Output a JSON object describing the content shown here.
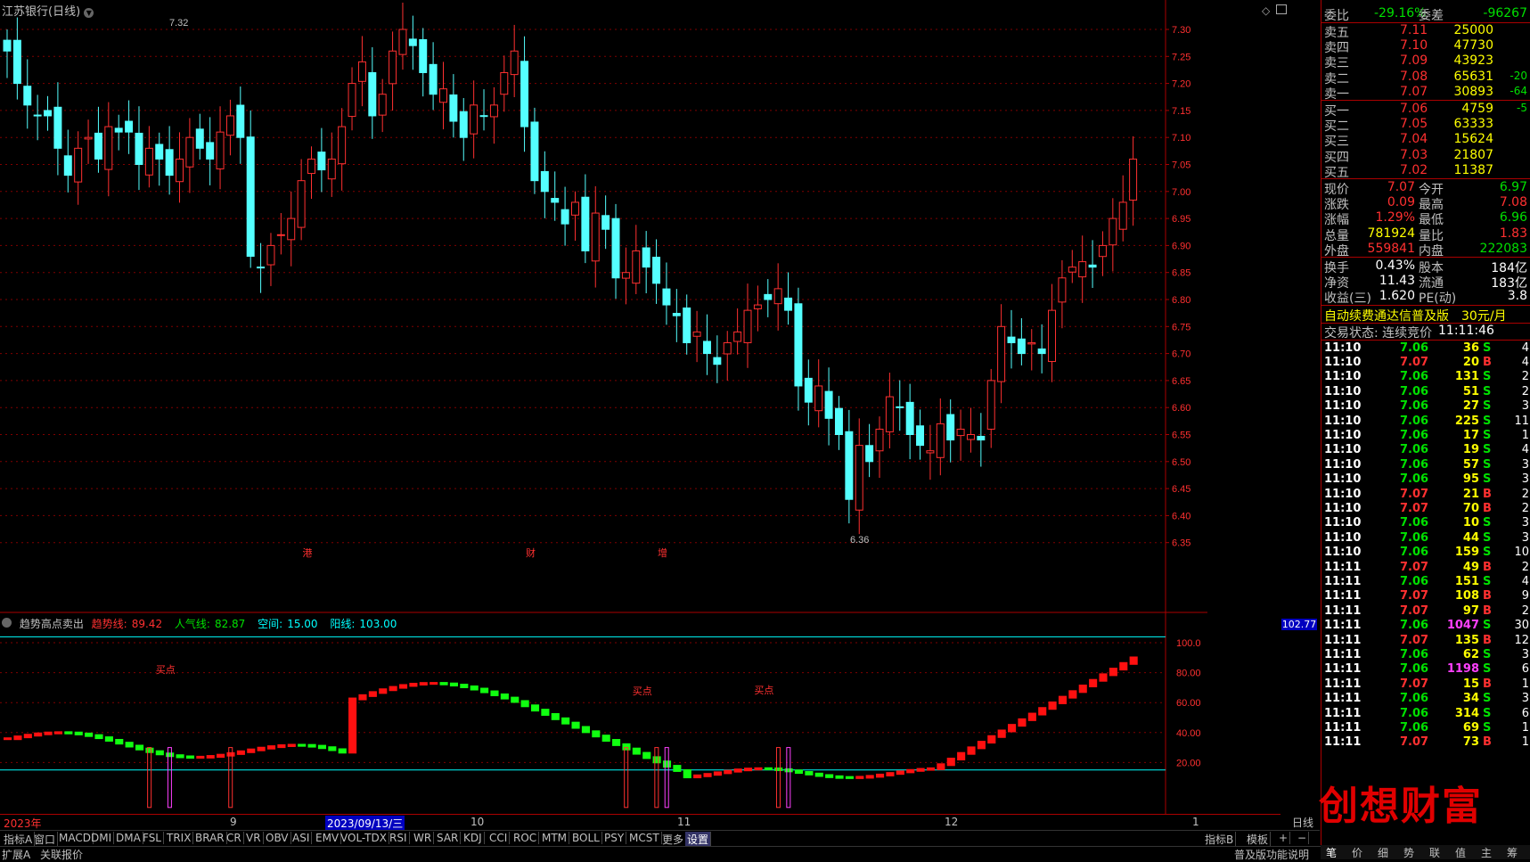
{
  "window": {
    "title": "江苏银行(日线)"
  },
  "colors": {
    "up": "#ff3030",
    "down": "#54ffff",
    "grid": "#800000",
    "accent": "#ffff00"
  },
  "main_chart": {
    "high_label": "7.32",
    "low_label": "6.36",
    "price_ticks": [
      "7.30",
      "7.25",
      "7.20",
      "7.15",
      "7.10",
      "7.05",
      "7.00",
      "6.95",
      "6.90",
      "6.85",
      "6.80",
      "6.75",
      "6.70",
      "6.65",
      "6.60",
      "6.55",
      "6.50",
      "6.45",
      "6.40",
      "6.35"
    ],
    "markers": [
      {
        "text": "港",
        "x_index": 30
      },
      {
        "text": "财",
        "x_index": 52
      },
      {
        "text": "增",
        "x_index": 65
      }
    ]
  },
  "indicator": {
    "name": "趋势高点卖出",
    "fields": [
      {
        "label": "趋势线:",
        "value": "89.42"
      },
      {
        "label": "人气线:",
        "value": "82.87"
      },
      {
        "label": "空间:",
        "value": "15.00"
      },
      {
        "label": "阳线:",
        "value": "103.00"
      }
    ],
    "current_value": "102.77",
    "ticks": [
      "100.0",
      "80.00",
      "60.00",
      "40.00",
      "20.00"
    ],
    "buy_labels": [
      "买点",
      "买点",
      "买点"
    ]
  },
  "x_axis": {
    "labels": [
      "2023年",
      "9",
      "2023/09/13/三",
      "10",
      "11",
      "12",
      "1"
    ],
    "period": "日线"
  },
  "tabs": [
    "指标A",
    "窗口",
    "MACD",
    "DMI",
    "DMA",
    "FSL",
    "TRIX",
    "BRAR",
    "CR",
    "VR",
    "OBV",
    "ASI",
    "EMV",
    "VOL-TDX",
    "RSI",
    "WR",
    "SAR",
    "KDJ",
    "CCI",
    "ROC",
    "MTM",
    "BOLL",
    "PSY",
    "MCST",
    "更多",
    "设置"
  ],
  "tabs_right": [
    "指标B",
    "模板",
    "+",
    "−"
  ],
  "statusbar": {
    "left": [
      "扩展A",
      "关联报价"
    ],
    "right": "普及版功能说明"
  },
  "quote": {
    "wei_bi": {
      "label": "委比",
      "value": "-29.16%",
      "label2": "委差",
      "value2": "-96267"
    },
    "sells": [
      {
        "label": "卖五",
        "price": "7.11",
        "vol": "25000",
        "chg": ""
      },
      {
        "label": "卖四",
        "price": "7.10",
        "vol": "47730",
        "chg": ""
      },
      {
        "label": "卖三",
        "price": "7.09",
        "vol": "43923",
        "chg": ""
      },
      {
        "label": "卖二",
        "price": "7.08",
        "vol": "65631",
        "chg": "-20"
      },
      {
        "label": "卖一",
        "price": "7.07",
        "vol": "30893",
        "chg": "-64"
      }
    ],
    "buys": [
      {
        "label": "买一",
        "price": "7.06",
        "vol": "4759",
        "chg": "-5"
      },
      {
        "label": "买二",
        "price": "7.05",
        "vol": "63333",
        "chg": ""
      },
      {
        "label": "买三",
        "price": "7.04",
        "vol": "15624",
        "chg": ""
      },
      {
        "label": "买四",
        "price": "7.03",
        "vol": "21807",
        "chg": ""
      },
      {
        "label": "买五",
        "price": "7.02",
        "vol": "11387",
        "chg": ""
      }
    ],
    "stats": [
      {
        "l1": "现价",
        "v1": "7.07",
        "c1": "red",
        "l2": "今开",
        "v2": "6.97",
        "c2": "green"
      },
      {
        "l1": "涨跌",
        "v1": "0.09",
        "c1": "red",
        "l2": "最高",
        "v2": "7.08",
        "c2": "red"
      },
      {
        "l1": "涨幅",
        "v1": "1.29%",
        "c1": "red",
        "l2": "最低",
        "v2": "6.96",
        "c2": "green"
      },
      {
        "l1": "总量",
        "v1": "781924",
        "c1": "yellow",
        "l2": "量比",
        "v2": "1.83",
        "c2": "red"
      },
      {
        "l1": "外盘",
        "v1": "559841",
        "c1": "red",
        "l2": "内盘",
        "v2": "222083",
        "c2": "green"
      }
    ],
    "stats2": [
      {
        "l1": "换手",
        "v1": "0.43%",
        "l2": "股本",
        "v2": "184亿"
      },
      {
        "l1": "净资",
        "v1": "11.43",
        "l2": "流通",
        "v2": "183亿"
      },
      {
        "l1": "收益(三)",
        "v1": "1.620",
        "l2": "PE(动)",
        "v2": "3.8"
      }
    ],
    "promo": {
      "text": "自动续费通达信普及版",
      "price": "30元/月"
    },
    "trade_state": {
      "label": "交易状态: 连续竞价",
      "time": "11:11:46"
    }
  },
  "ticks": [
    {
      "t": "11:10",
      "p": "7.06",
      "v": "36",
      "bs": "S",
      "n": "4"
    },
    {
      "t": "11:10",
      "p": "7.07",
      "v": "20",
      "bs": "B",
      "n": "4"
    },
    {
      "t": "11:10",
      "p": "7.06",
      "v": "131",
      "bs": "S",
      "n": "2"
    },
    {
      "t": "11:10",
      "p": "7.06",
      "v": "51",
      "bs": "S",
      "n": "2"
    },
    {
      "t": "11:10",
      "p": "7.06",
      "v": "27",
      "bs": "S",
      "n": "3"
    },
    {
      "t": "11:10",
      "p": "7.06",
      "v": "225",
      "bs": "S",
      "n": "11"
    },
    {
      "t": "11:10",
      "p": "7.06",
      "v": "17",
      "bs": "S",
      "n": "1"
    },
    {
      "t": "11:10",
      "p": "7.06",
      "v": "19",
      "bs": "S",
      "n": "4"
    },
    {
      "t": "11:10",
      "p": "7.06",
      "v": "57",
      "bs": "S",
      "n": "3"
    },
    {
      "t": "11:10",
      "p": "7.06",
      "v": "95",
      "bs": "S",
      "n": "3"
    },
    {
      "t": "11:10",
      "p": "7.07",
      "v": "21",
      "bs": "B",
      "n": "2"
    },
    {
      "t": "11:10",
      "p": "7.07",
      "v": "70",
      "bs": "B",
      "n": "2"
    },
    {
      "t": "11:10",
      "p": "7.06",
      "v": "10",
      "bs": "S",
      "n": "3"
    },
    {
      "t": "11:10",
      "p": "7.06",
      "v": "44",
      "bs": "S",
      "n": "3"
    },
    {
      "t": "11:10",
      "p": "7.06",
      "v": "159",
      "bs": "S",
      "n": "10"
    },
    {
      "t": "11:11",
      "p": "7.07",
      "v": "49",
      "bs": "B",
      "n": "2"
    },
    {
      "t": "11:11",
      "p": "7.06",
      "v": "151",
      "bs": "S",
      "n": "4"
    },
    {
      "t": "11:11",
      "p": "7.07",
      "v": "108",
      "bs": "B",
      "n": "9"
    },
    {
      "t": "11:11",
      "p": "7.07",
      "v": "97",
      "bs": "B",
      "n": "2"
    },
    {
      "t": "11:11",
      "p": "7.06",
      "v": "1047",
      "bs": "S",
      "n": "30"
    },
    {
      "t": "11:11",
      "p": "7.07",
      "v": "135",
      "bs": "B",
      "n": "12"
    },
    {
      "t": "11:11",
      "p": "7.06",
      "v": "62",
      "bs": "S",
      "n": "3"
    },
    {
      "t": "11:11",
      "p": "7.06",
      "v": "1198",
      "bs": "S",
      "n": "6"
    },
    {
      "t": "11:11",
      "p": "7.07",
      "v": "15",
      "bs": "B",
      "n": "1"
    },
    {
      "t": "11:11",
      "p": "7.06",
      "v": "34",
      "bs": "S",
      "n": "3"
    },
    {
      "t": "11:11",
      "p": "7.06",
      "v": "314",
      "bs": "S",
      "n": "6"
    },
    {
      "t": "11:11",
      "p": "7.06",
      "v": "69",
      "bs": "S",
      "n": "1"
    },
    {
      "t": "11:11",
      "p": "7.07",
      "v": "73",
      "bs": "B",
      "n": "1"
    }
  ],
  "right_tabs": [
    "笔",
    "价",
    "细",
    "势",
    "联",
    "值",
    "主",
    "筹"
  ],
  "watermark": "创想财富"
}
